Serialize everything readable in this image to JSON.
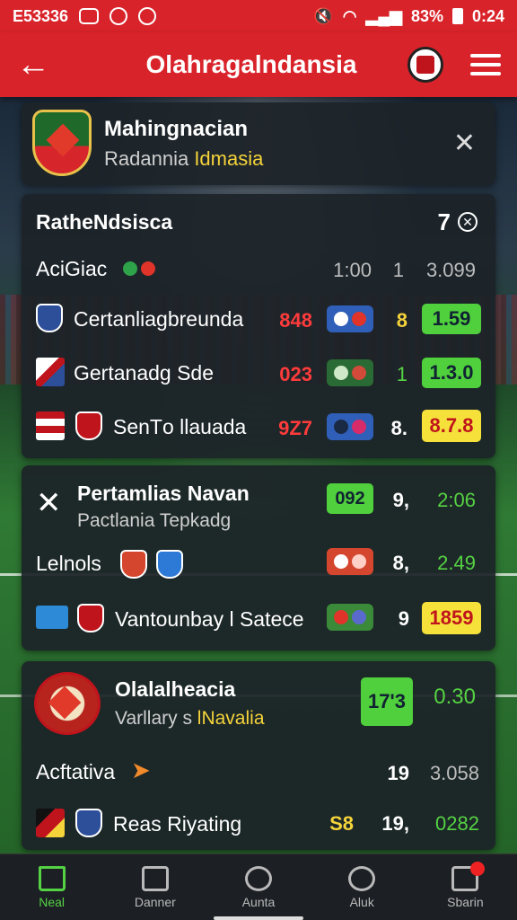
{
  "status_bar": {
    "time_left": "E53336",
    "battery": "83%",
    "clock": "0:24"
  },
  "app_bar": {
    "title": "Olahragalndansia"
  },
  "header_card": {
    "title": "Mahingnacian",
    "subtitle_a": "Radannia ",
    "subtitle_b": "Idmasia"
  },
  "league_card": {
    "title": "RatheNdsisca",
    "count": "7",
    "summary": {
      "label": "AciGiac",
      "time": "1:00",
      "n": "1",
      "odds": "3.099"
    },
    "matches": [
      {
        "team": "Certanliagbreunda",
        "score": "848",
        "mid": "8",
        "odds": "1.59",
        "odds_style": "green"
      },
      {
        "team": "Gertanadg Sde",
        "score": "023",
        "mid": "1",
        "odds": "1.3.0",
        "odds_style": "green"
      },
      {
        "team": "SenТo llauada",
        "score": "9Z7",
        "mid": "8.",
        "odds": "8.7.8",
        "odds_style": "yellow"
      }
    ]
  },
  "card3": {
    "title": "Pertamlias Navan",
    "subtitle": "Pactlania Tepkadg",
    "top_badge": "092",
    "top_mid": "9,",
    "top_odds": "2:06",
    "row2": {
      "label": "Lelnols",
      "mid": "8,",
      "odds": "2.49"
    },
    "row3": {
      "team": "Vantounbay l Satece",
      "mid": "9",
      "odds": "1859"
    }
  },
  "card4": {
    "title": "Olalalheacia",
    "subtitle_a": "Varllary s ",
    "subtitle_b": "lNavalia",
    "badge": "17'3",
    "odds": "0.30",
    "row2": {
      "label": "Acftativa",
      "mid": "19",
      "odds": "3.058"
    },
    "row3": {
      "team": "Reas Riyating",
      "left": "S8",
      "mid": "19,",
      "odds": "0282"
    }
  },
  "bottom_nav": [
    {
      "label": "Neal",
      "icon": "home-icon",
      "active": true
    },
    {
      "label": "Danner",
      "icon": "calendar-icon",
      "active": false
    },
    {
      "label": "Aunta",
      "icon": "clock-icon",
      "active": false
    },
    {
      "label": "Aluk",
      "icon": "search-icon",
      "active": false
    },
    {
      "label": "Sbarin",
      "icon": "chat-icon",
      "active": false
    }
  ],
  "colors": {
    "brand_red": "#d9232a",
    "odds_green": "#4fd03c",
    "odds_yellow": "#f5e13a"
  }
}
